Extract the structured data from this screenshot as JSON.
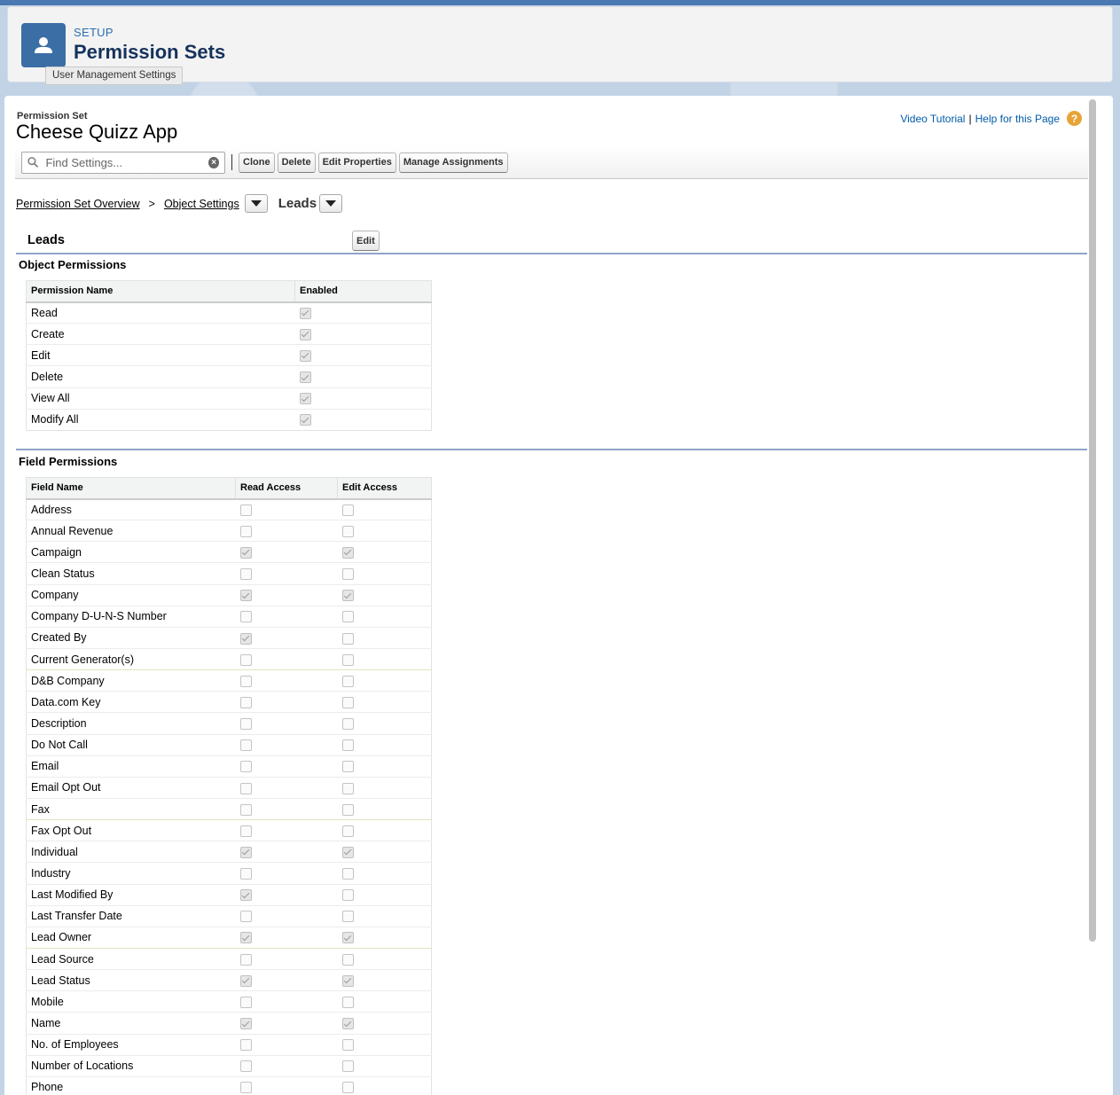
{
  "header": {
    "setup_label": "SETUP",
    "title": "Permission Sets",
    "tooltip": "User Management Settings"
  },
  "permission_set": {
    "label": "Permission Set",
    "name": "Cheese Quizz App"
  },
  "help": {
    "video_tutorial": "Video Tutorial",
    "separator": "|",
    "help_page": "Help for this Page",
    "help_icon_glyph": "?"
  },
  "toolbar": {
    "search_placeholder": "Find Settings...",
    "clone": "Clone",
    "delete": "Delete",
    "edit_properties": "Edit Properties",
    "manage_assignments": "Manage Assignments"
  },
  "breadcrumb": {
    "overview": "Permission Set Overview",
    "arrow": ">",
    "object_settings": "Object Settings",
    "current": "Leads"
  },
  "section": {
    "title": "Leads",
    "edit": "Edit",
    "object_permissions_title": "Object Permissions",
    "field_permissions_title": "Field Permissions"
  },
  "object_permissions": {
    "headers": [
      "Permission Name",
      "Enabled"
    ],
    "rows": [
      {
        "name": "Read",
        "enabled": true
      },
      {
        "name": "Create",
        "enabled": true
      },
      {
        "name": "Edit",
        "enabled": true
      },
      {
        "name": "Delete",
        "enabled": true
      },
      {
        "name": "View All",
        "enabled": true
      },
      {
        "name": "Modify All",
        "enabled": true
      }
    ]
  },
  "field_permissions": {
    "headers": [
      "Field Name",
      "Read Access",
      "Edit Access"
    ],
    "rows": [
      {
        "name": "Address",
        "read": false,
        "edit": false
      },
      {
        "name": "Annual Revenue",
        "read": false,
        "edit": false
      },
      {
        "name": "Campaign",
        "read": true,
        "edit": true
      },
      {
        "name": "Clean Status",
        "read": false,
        "edit": false
      },
      {
        "name": "Company",
        "read": true,
        "edit": true
      },
      {
        "name": "Company D-U-N-S Number",
        "read": false,
        "edit": false
      },
      {
        "name": "Created By",
        "read": true,
        "edit": false
      },
      {
        "name": "Current Generator(s)",
        "read": false,
        "edit": false
      },
      {
        "name": "D&B Company",
        "read": false,
        "edit": false
      },
      {
        "name": "Data.com Key",
        "read": false,
        "edit": false
      },
      {
        "name": "Description",
        "read": false,
        "edit": false
      },
      {
        "name": "Do Not Call",
        "read": false,
        "edit": false
      },
      {
        "name": "Email",
        "read": false,
        "edit": false
      },
      {
        "name": "Email Opt Out",
        "read": false,
        "edit": false
      },
      {
        "name": "Fax",
        "read": false,
        "edit": false
      },
      {
        "name": "Fax Opt Out",
        "read": false,
        "edit": false
      },
      {
        "name": "Individual",
        "read": true,
        "edit": true
      },
      {
        "name": "Industry",
        "read": false,
        "edit": false
      },
      {
        "name": "Last Modified By",
        "read": true,
        "edit": false
      },
      {
        "name": "Last Transfer Date",
        "read": false,
        "edit": false
      },
      {
        "name": "Lead Owner",
        "read": true,
        "edit": true
      },
      {
        "name": "Lead Source",
        "read": false,
        "edit": false
      },
      {
        "name": "Lead Status",
        "read": true,
        "edit": true
      },
      {
        "name": "Mobile",
        "read": false,
        "edit": false
      },
      {
        "name": "Name",
        "read": true,
        "edit": true
      },
      {
        "name": "No. of Employees",
        "read": false,
        "edit": false
      },
      {
        "name": "Number of Locations",
        "read": false,
        "edit": false
      },
      {
        "name": "Phone",
        "read": false,
        "edit": false
      }
    ]
  },
  "colors": {
    "header_icon_bg": "#3b6ea5",
    "link": "#015ba7",
    "help_icon": "#e8a337",
    "section_rule": "#8ea5c8"
  }
}
